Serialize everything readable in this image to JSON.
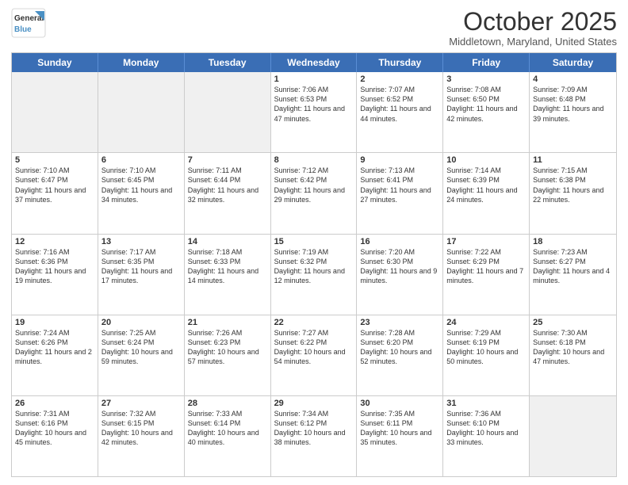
{
  "header": {
    "logo_general": "General",
    "logo_blue": "Blue",
    "month": "October 2025",
    "location": "Middletown, Maryland, United States"
  },
  "days_of_week": [
    "Sunday",
    "Monday",
    "Tuesday",
    "Wednesday",
    "Thursday",
    "Friday",
    "Saturday"
  ],
  "weeks": [
    [
      {
        "day": "",
        "info": "",
        "shade": true
      },
      {
        "day": "",
        "info": "",
        "shade": true
      },
      {
        "day": "",
        "info": "",
        "shade": true
      },
      {
        "day": "1",
        "info": "Sunrise: 7:06 AM\nSunset: 6:53 PM\nDaylight: 11 hours and 47 minutes.",
        "shade": false
      },
      {
        "day": "2",
        "info": "Sunrise: 7:07 AM\nSunset: 6:52 PM\nDaylight: 11 hours and 44 minutes.",
        "shade": false
      },
      {
        "day": "3",
        "info": "Sunrise: 7:08 AM\nSunset: 6:50 PM\nDaylight: 11 hours and 42 minutes.",
        "shade": false
      },
      {
        "day": "4",
        "info": "Sunrise: 7:09 AM\nSunset: 6:48 PM\nDaylight: 11 hours and 39 minutes.",
        "shade": false
      }
    ],
    [
      {
        "day": "5",
        "info": "Sunrise: 7:10 AM\nSunset: 6:47 PM\nDaylight: 11 hours and 37 minutes.",
        "shade": false
      },
      {
        "day": "6",
        "info": "Sunrise: 7:10 AM\nSunset: 6:45 PM\nDaylight: 11 hours and 34 minutes.",
        "shade": false
      },
      {
        "day": "7",
        "info": "Sunrise: 7:11 AM\nSunset: 6:44 PM\nDaylight: 11 hours and 32 minutes.",
        "shade": false
      },
      {
        "day": "8",
        "info": "Sunrise: 7:12 AM\nSunset: 6:42 PM\nDaylight: 11 hours and 29 minutes.",
        "shade": false
      },
      {
        "day": "9",
        "info": "Sunrise: 7:13 AM\nSunset: 6:41 PM\nDaylight: 11 hours and 27 minutes.",
        "shade": false
      },
      {
        "day": "10",
        "info": "Sunrise: 7:14 AM\nSunset: 6:39 PM\nDaylight: 11 hours and 24 minutes.",
        "shade": false
      },
      {
        "day": "11",
        "info": "Sunrise: 7:15 AM\nSunset: 6:38 PM\nDaylight: 11 hours and 22 minutes.",
        "shade": false
      }
    ],
    [
      {
        "day": "12",
        "info": "Sunrise: 7:16 AM\nSunset: 6:36 PM\nDaylight: 11 hours and 19 minutes.",
        "shade": false
      },
      {
        "day": "13",
        "info": "Sunrise: 7:17 AM\nSunset: 6:35 PM\nDaylight: 11 hours and 17 minutes.",
        "shade": false
      },
      {
        "day": "14",
        "info": "Sunrise: 7:18 AM\nSunset: 6:33 PM\nDaylight: 11 hours and 14 minutes.",
        "shade": false
      },
      {
        "day": "15",
        "info": "Sunrise: 7:19 AM\nSunset: 6:32 PM\nDaylight: 11 hours and 12 minutes.",
        "shade": false
      },
      {
        "day": "16",
        "info": "Sunrise: 7:20 AM\nSunset: 6:30 PM\nDaylight: 11 hours and 9 minutes.",
        "shade": false
      },
      {
        "day": "17",
        "info": "Sunrise: 7:22 AM\nSunset: 6:29 PM\nDaylight: 11 hours and 7 minutes.",
        "shade": false
      },
      {
        "day": "18",
        "info": "Sunrise: 7:23 AM\nSunset: 6:27 PM\nDaylight: 11 hours and 4 minutes.",
        "shade": false
      }
    ],
    [
      {
        "day": "19",
        "info": "Sunrise: 7:24 AM\nSunset: 6:26 PM\nDaylight: 11 hours and 2 minutes.",
        "shade": false
      },
      {
        "day": "20",
        "info": "Sunrise: 7:25 AM\nSunset: 6:24 PM\nDaylight: 10 hours and 59 minutes.",
        "shade": false
      },
      {
        "day": "21",
        "info": "Sunrise: 7:26 AM\nSunset: 6:23 PM\nDaylight: 10 hours and 57 minutes.",
        "shade": false
      },
      {
        "day": "22",
        "info": "Sunrise: 7:27 AM\nSunset: 6:22 PM\nDaylight: 10 hours and 54 minutes.",
        "shade": false
      },
      {
        "day": "23",
        "info": "Sunrise: 7:28 AM\nSunset: 6:20 PM\nDaylight: 10 hours and 52 minutes.",
        "shade": false
      },
      {
        "day": "24",
        "info": "Sunrise: 7:29 AM\nSunset: 6:19 PM\nDaylight: 10 hours and 50 minutes.",
        "shade": false
      },
      {
        "day": "25",
        "info": "Sunrise: 7:30 AM\nSunset: 6:18 PM\nDaylight: 10 hours and 47 minutes.",
        "shade": false
      }
    ],
    [
      {
        "day": "26",
        "info": "Sunrise: 7:31 AM\nSunset: 6:16 PM\nDaylight: 10 hours and 45 minutes.",
        "shade": false
      },
      {
        "day": "27",
        "info": "Sunrise: 7:32 AM\nSunset: 6:15 PM\nDaylight: 10 hours and 42 minutes.",
        "shade": false
      },
      {
        "day": "28",
        "info": "Sunrise: 7:33 AM\nSunset: 6:14 PM\nDaylight: 10 hours and 40 minutes.",
        "shade": false
      },
      {
        "day": "29",
        "info": "Sunrise: 7:34 AM\nSunset: 6:12 PM\nDaylight: 10 hours and 38 minutes.",
        "shade": false
      },
      {
        "day": "30",
        "info": "Sunrise: 7:35 AM\nSunset: 6:11 PM\nDaylight: 10 hours and 35 minutes.",
        "shade": false
      },
      {
        "day": "31",
        "info": "Sunrise: 7:36 AM\nSunset: 6:10 PM\nDaylight: 10 hours and 33 minutes.",
        "shade": false
      },
      {
        "day": "",
        "info": "",
        "shade": true
      }
    ]
  ]
}
